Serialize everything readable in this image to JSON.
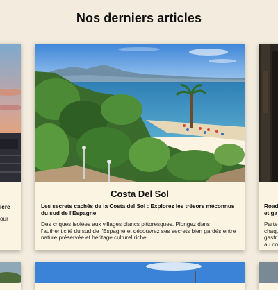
{
  "page": {
    "section_title": "Nos derniers articles"
  },
  "articles": [
    {
      "title": "",
      "subtitle": "ière",
      "excerpt": "our"
    },
    {
      "title": "Costa Del Sol",
      "subtitle": "Les secrets cachés de la Costa del Sol : Explorez les trésors méconnus du sud de l'Espagne",
      "excerpt": "Des criques isolées aux villages blancs pittoresques. Plongez dans l'authenticité du sud de l'Espagne et découvrez ses secrets bien gardés entre nature préservée et héritage culturel riche."
    },
    {
      "title": "",
      "subtitle": "Road\net ga",
      "excerpt": "Parte\nchaqu\ngastr\nau co"
    }
  ],
  "colors": {
    "background": "#f3ecde",
    "card": "#fbf4e3"
  }
}
